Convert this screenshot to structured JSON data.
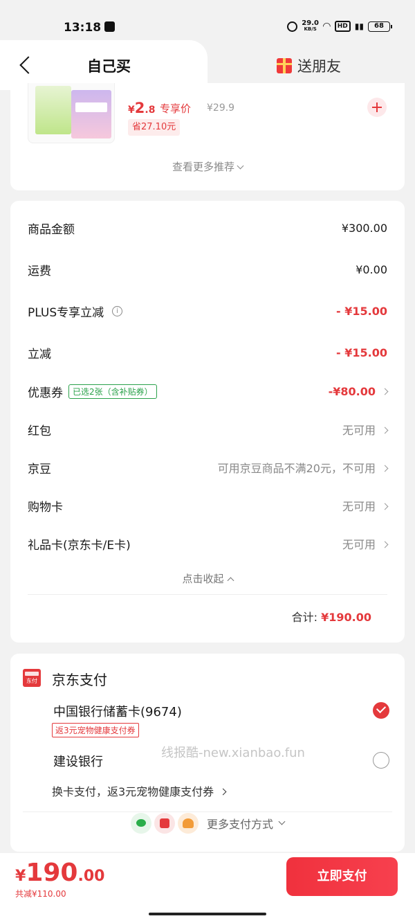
{
  "status": {
    "time": "13:18",
    "net_speed": "29.0",
    "net_unit": "KB/S",
    "hd": "HD",
    "battery": "68"
  },
  "tabs": {
    "self_label": "自己买",
    "gift_label": "送朋友"
  },
  "recommend": {
    "price_currency": "¥",
    "price_int": "2",
    "price_dec": ".8",
    "price_tag": "专享价",
    "original_price": "¥29.9",
    "save_label": "省27.10元",
    "more_label": "查看更多推荐"
  },
  "summary": {
    "rows": [
      {
        "label": "商品金额",
        "value": "¥300.00"
      },
      {
        "label": "运费",
        "value": "¥0.00"
      },
      {
        "label": "PLUS专享立减",
        "value": "- ¥15.00"
      },
      {
        "label": "立减",
        "value": "- ¥15.00"
      },
      {
        "label": "优惠券",
        "badge": "已选2张（含补贴券）",
        "value": "-¥80.00"
      },
      {
        "label": "红包",
        "value": "无可用"
      },
      {
        "label": "京豆",
        "value": "可用京豆商品不满20元，不可用"
      },
      {
        "label": "购物卡",
        "value": "无可用"
      },
      {
        "label": "礼品卡(京东卡/E卡)",
        "value": "无可用"
      }
    ],
    "collapse_label": "点击收起",
    "total_label": "合计:",
    "total_value": "¥190.00"
  },
  "payment": {
    "title": "京东支付",
    "icon_text": "东付",
    "options": [
      {
        "label": "中国银行储蓄卡(9674)",
        "promo": "返3元宠物健康支付券",
        "selected": true
      },
      {
        "label": "建设银行",
        "selected": false
      }
    ],
    "switch_label": "换卡支付，返3元宠物健康支付券",
    "more_label": "更多支付方式"
  },
  "watermark": "线报酷-new.xianbao.fun",
  "bottom": {
    "currency": "¥",
    "price_int": "190",
    "price_dec": ".00",
    "saved_label": "共减¥110.00",
    "pay_button": "立即支付"
  },
  "colors": {
    "accent": "#e4393c",
    "coupon_green": "#2aa14a",
    "background": "#f2f2f2"
  }
}
